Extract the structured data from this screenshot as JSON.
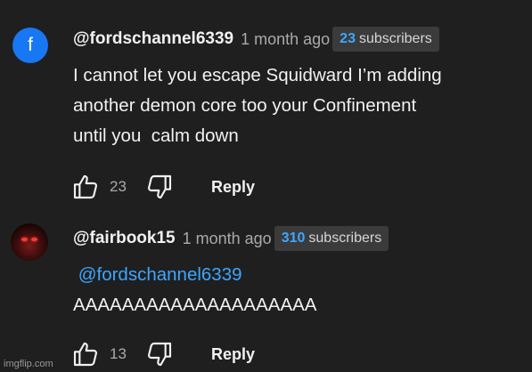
{
  "comments": [
    {
      "avatar_letter": "f",
      "avatar_color": "#1877f2",
      "handle": "@fordschannel6339",
      "time": "1 month ago",
      "subscriber_count": "23",
      "subscriber_label": "subscribers",
      "lines": [
        "I cannot let you escape Squidward I’m adding",
        "another demon core too your Confinement",
        "until you  calm down"
      ],
      "likes": "23",
      "reply_label": "Reply"
    },
    {
      "handle": "@fairbook15",
      "time": "1 month ago",
      "subscriber_count": "310",
      "subscriber_label": "subscribers",
      "mention": "@fordschannel6339",
      "lines": [
        "AAAAAAAAAAAAAAAAAAAA"
      ],
      "likes": "13",
      "reply_label": "Reply"
    }
  ],
  "icons": {
    "like": "thumbs-up-icon",
    "dislike": "thumbs-down-icon"
  },
  "colors": {
    "background": "#1f1f1f",
    "link": "#3ea6ff",
    "badge": "#3b3b3b"
  },
  "watermark": "imgflip.com"
}
